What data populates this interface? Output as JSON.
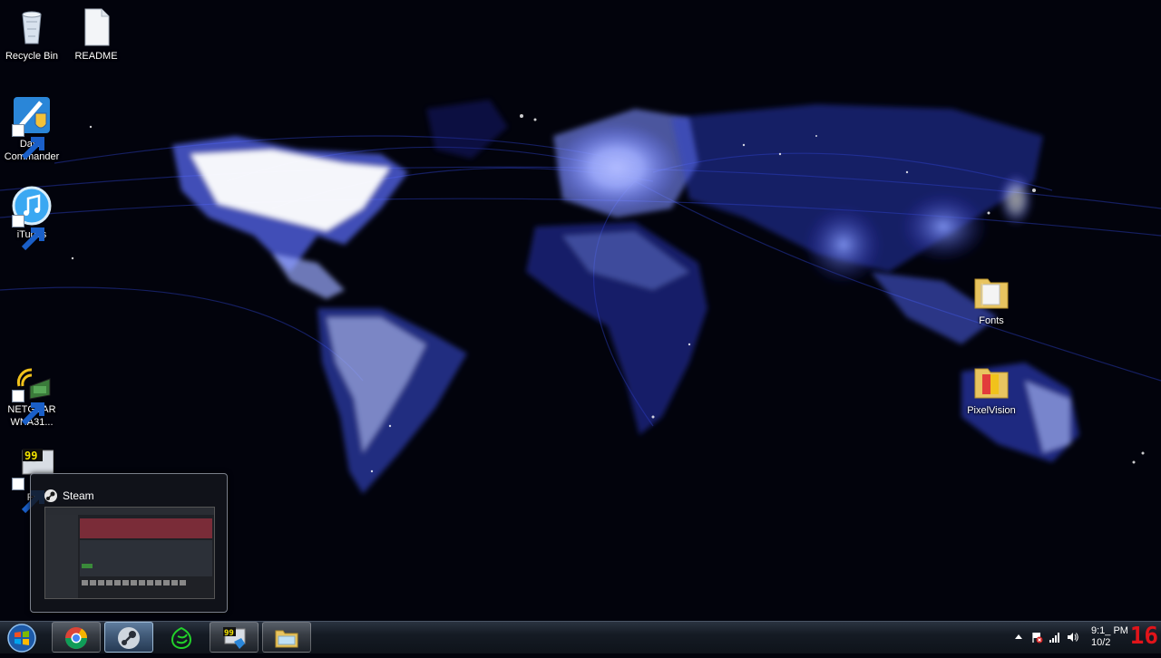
{
  "desktop": {
    "icons": [
      {
        "name": "recycle-bin",
        "label": "Recycle Bin"
      },
      {
        "name": "readme",
        "label": "README"
      },
      {
        "name": "dayz-commander",
        "label": "DayZ Commander"
      },
      {
        "name": "itunes",
        "label": "iTunes"
      },
      {
        "name": "netgear",
        "label": "NETGEAR WNA31..."
      },
      {
        "name": "fraps",
        "label": "Fr"
      },
      {
        "name": "fonts",
        "label": "Fonts"
      },
      {
        "name": "pixelvision",
        "label": "PixelVision"
      }
    ],
    "wallpaper": "world-city-lights-map"
  },
  "preview": {
    "title": "Steam",
    "icon": "steam-icon"
  },
  "taskbar": {
    "start": "windows-start-orb",
    "buttons": [
      {
        "name": "chrome",
        "icon": "chrome-icon"
      },
      {
        "name": "steam",
        "icon": "steam-icon",
        "active": true
      },
      {
        "name": "razer",
        "icon": "razer-icon"
      },
      {
        "name": "fraps",
        "icon": "fraps-icon"
      },
      {
        "name": "explorer",
        "icon": "folder-icon"
      }
    ]
  },
  "tray": {
    "time": "9:1_ PM",
    "date": "10/2",
    "counter": "16"
  },
  "colors": {
    "accent": "#4b6cff",
    "counter": "#e0141a"
  }
}
